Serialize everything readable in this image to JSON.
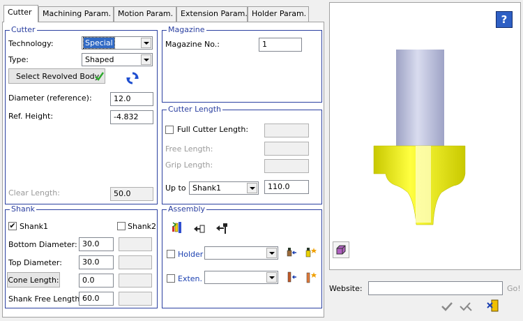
{
  "tabs": [
    "Cutter",
    "Machining Param.",
    "Motion Param.",
    "Extension Param.",
    "Holder Param."
  ],
  "cutter": {
    "title": "Cutter",
    "technology_label": "Technology:",
    "technology_value": "Special",
    "type_label": "Type:",
    "type_value": "Shaped",
    "select_button": "Select Revolved Body",
    "diameter_label": "Diameter (reference):",
    "diameter_value": "12.0",
    "ref_height_label": "Ref. Height:",
    "ref_height_value": "-4.832",
    "clear_length_label": "Clear Length:",
    "clear_length_value": "50.0"
  },
  "magazine": {
    "title": "Magazine",
    "no_label": "Magazine No.:",
    "no_value": "1"
  },
  "cutter_length": {
    "title": "Cutter Length",
    "full_label": "Full Cutter Length:",
    "free_label": "Free Length:",
    "grip_label": "Grip Length:",
    "upto_label": "Up to",
    "upto_value": "Shank1",
    "upto_length": "110.0"
  },
  "shank": {
    "title": "Shank",
    "shank1_label": "Shank1",
    "shank1_checked": "✔",
    "shank2_label": "Shank2",
    "bottom_label": "Bottom Diameter:",
    "bottom_value": "30.0",
    "top_label": "Top Diameter:",
    "top_value": "30.0",
    "cone_button": "Cone Length:",
    "cone_value": "0.0",
    "free_label": "Shank Free Length:",
    "free_value": "60.0"
  },
  "assembly": {
    "title": "Assembly",
    "holder_label": "Holder",
    "exten_label": "Exten."
  },
  "preview": {
    "help_glyph": "?",
    "website_label": "Website:",
    "website_value": "",
    "go_label": "Go!"
  },
  "colors": {
    "group_border": "#2a3fa0",
    "shank": "#b7bbd6",
    "cutter": "#f3f300"
  }
}
